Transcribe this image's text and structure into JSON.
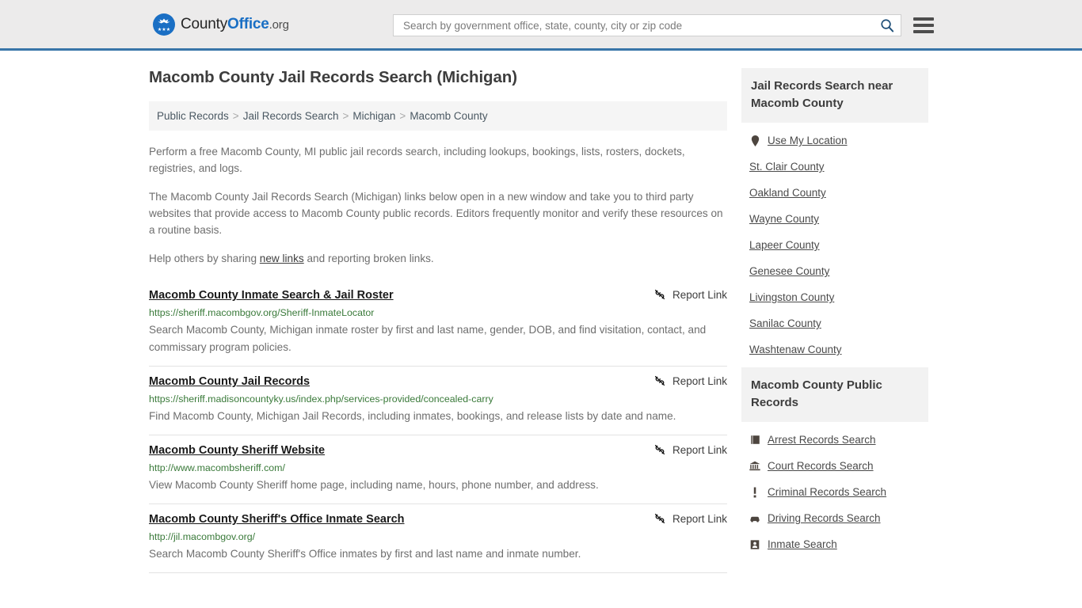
{
  "header": {
    "logo": {
      "icon": "county-office-seal-icon",
      "part1": "County",
      "part2": "Office",
      "part3": ".org"
    },
    "search": {
      "placeholder": "Search by government office, state, county, city or zip code",
      "value": "",
      "icon": "search-icon"
    },
    "menu_icon": "hamburger-menu-icon",
    "accent_color": "#3875a8",
    "background_color": "#ecebeb"
  },
  "main": {
    "title": "Macomb County Jail Records Search (Michigan)",
    "breadcrumb": [
      "Public Records",
      "Jail Records Search",
      "Michigan",
      "Macomb County"
    ],
    "breadcrumb_separator": ">",
    "intro_paragraphs": [
      "Perform a free Macomb County, MI public jail records search, including lookups, bookings, lists, rosters, dockets, registries, and logs.",
      "The Macomb County Jail Records Search (Michigan) links below open in a new window and take you to third party websites that provide access to Macomb County public records. Editors frequently monitor and verify these resources on a routine basis."
    ],
    "help_text_before": "Help others by sharing ",
    "help_link": "new links",
    "help_text_after": " and reporting broken links.",
    "report_label": "Report Link",
    "report_icon": "broken-link-icon",
    "results": [
      {
        "title": "Macomb County Inmate Search & Jail Roster",
        "url": "https://sheriff.macombgov.org/Sheriff-InmateLocator",
        "description": "Search Macomb County, Michigan inmate roster by first and last name, gender, DOB, and find visitation, contact, and commissary program policies."
      },
      {
        "title": "Macomb County Jail Records",
        "url": "https://sheriff.madisoncountyky.us/index.php/services-provided/concealed-carry",
        "description": "Find Macomb County, Michigan Jail Records, including inmates, bookings, and release lists by date and name."
      },
      {
        "title": "Macomb County Sheriff Website",
        "url": "http://www.macombsheriff.com/",
        "description": "View Macomb County Sheriff home page, including name, hours, phone number, and address."
      },
      {
        "title": "Macomb County Sheriff's Office Inmate Search",
        "url": "http://jil.macombgov.org/",
        "description": "Search Macomb County Sheriff's Office inmates by first and last name and inmate number."
      }
    ]
  },
  "sidebar": {
    "panels": [
      {
        "heading": "Jail Records Search near Macomb County",
        "items": [
          {
            "label": "Use My Location",
            "icon": "map-pin-icon"
          },
          {
            "label": "St. Clair County",
            "icon": ""
          },
          {
            "label": "Oakland County",
            "icon": ""
          },
          {
            "label": "Wayne County",
            "icon": ""
          },
          {
            "label": "Lapeer County",
            "icon": ""
          },
          {
            "label": "Genesee County",
            "icon": ""
          },
          {
            "label": "Livingston County",
            "icon": ""
          },
          {
            "label": "Sanilac County",
            "icon": ""
          },
          {
            "label": "Washtenaw County",
            "icon": ""
          }
        ]
      },
      {
        "heading": "Macomb County Public Records",
        "items": [
          {
            "label": "Arrest Records Search",
            "icon": "book-icon"
          },
          {
            "label": "Court Records Search",
            "icon": "courthouse-icon"
          },
          {
            "label": "Criminal Records Search",
            "icon": "exclamation-icon"
          },
          {
            "label": "Driving Records Search",
            "icon": "car-icon"
          },
          {
            "label": "Inmate Search",
            "icon": "id-card-icon"
          }
        ]
      }
    ]
  }
}
